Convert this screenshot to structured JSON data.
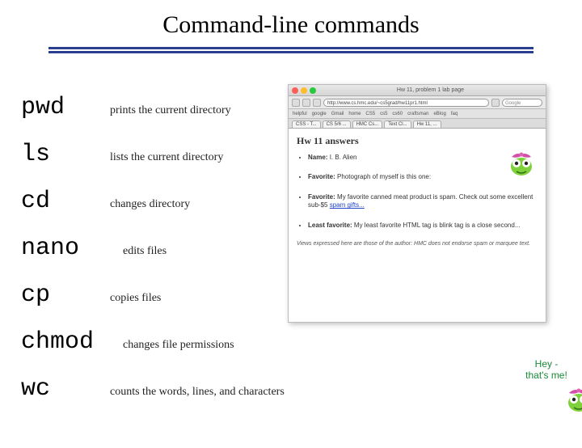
{
  "title": "Command-line  commands",
  "commands": [
    {
      "cmd": "pwd",
      "desc": "prints the current directory"
    },
    {
      "cmd": "ls",
      "desc": "lists the current directory"
    },
    {
      "cmd": "cd",
      "desc": "changes directory"
    },
    {
      "cmd": "nano",
      "desc": "edits files"
    },
    {
      "cmd": "cp",
      "desc": "copies files"
    },
    {
      "cmd": "chmod",
      "desc": "changes file permissions"
    },
    {
      "cmd": "wc",
      "desc": "counts the words, lines, and characters"
    }
  ],
  "browser": {
    "window_title": "Hw 11, problem 1 lab page",
    "url": "http://www.cs.hmc.edu/~cs5grad/hw11pr1.html",
    "search_placeholder": "Google",
    "bookmarks": [
      "helpful",
      "google",
      "Gmail",
      "home",
      "CS5",
      "cs5",
      "cs60",
      "craftsman",
      "eBlog",
      "faq"
    ],
    "tabs": [
      "CSS - T...",
      "CS 5/6 ...",
      "HMC Cs...",
      "Text Cl...",
      "Hw 11, ..."
    ],
    "page_heading": "Hw 11 answers",
    "items": [
      {
        "label": "Name:",
        "text": "I. B. Alien"
      },
      {
        "label": "Favorite:",
        "text": "Photograph of myself is this one:"
      },
      {
        "label": "Favorite:",
        "text": "My favorite canned meat product is spam. Check out some excellent sub-$5 ",
        "link": "spam gifts..."
      },
      {
        "label": "Least favorite:",
        "text": "My least favorite HTML tag is blink tag is a close second..."
      }
    ],
    "footer": "Views expressed here are those of the author: HMC does not endorse spam or marquee text."
  },
  "speech": "Hey - that's me!"
}
